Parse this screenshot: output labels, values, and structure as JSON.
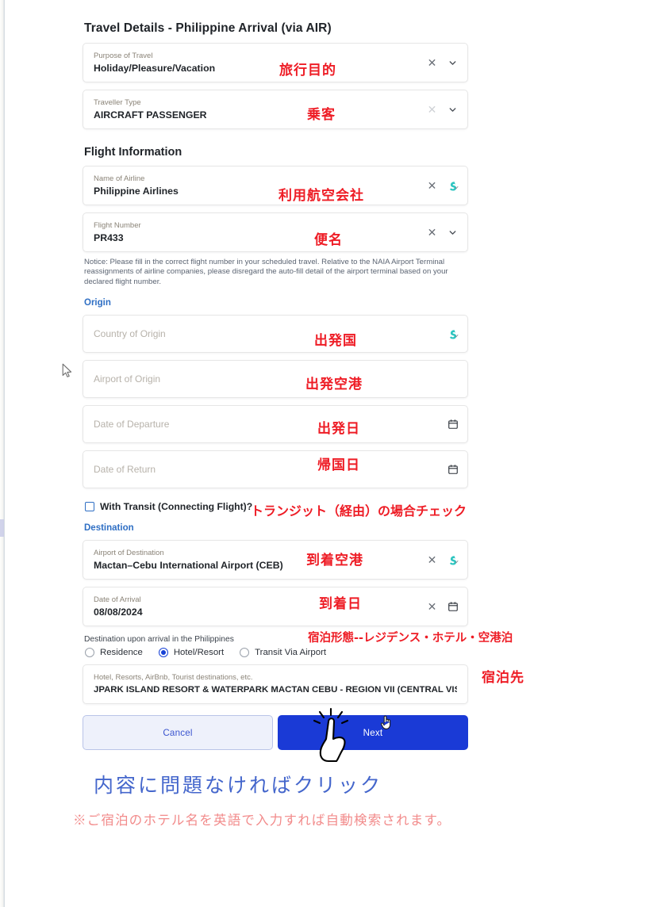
{
  "page": {
    "title": "Travel Details - Philippine Arrival (via AIR)",
    "flight_section_title": "Flight Information"
  },
  "fields": {
    "purpose": {
      "label": "Purpose of Travel",
      "value": "Holiday/Pleasure/Vacation"
    },
    "traveller_type": {
      "label": "Traveller Type",
      "value": "AIRCRAFT PASSENGER"
    },
    "airline": {
      "label": "Name of Airline",
      "value": "Philippine Airlines"
    },
    "flight_number": {
      "label": "Flight Number",
      "value": "PR433"
    },
    "country_origin": {
      "placeholder": "Country of Origin",
      "value": ""
    },
    "airport_origin": {
      "placeholder": "Airport of Origin",
      "value": ""
    },
    "date_departure": {
      "placeholder": "Date of Departure",
      "value": ""
    },
    "date_return": {
      "placeholder": "Date of Return",
      "value": ""
    },
    "airport_destination": {
      "label": "Airport of Destination",
      "value": "Mactan–Cebu International Airport (CEB)"
    },
    "date_arrival": {
      "label": "Date of Arrival",
      "value": "08/08/2024"
    },
    "hotel": {
      "label": "Hotel, Resorts, AirBnb, Tourist destinations, etc.",
      "value": "JPARK ISLAND RESORT & WATERPARK MACTAN CEBU - REGION VII (CENTRAL VISAYAS) -LAPU-I"
    }
  },
  "notice": "Notice: Please fill in the correct flight number in your scheduled travel. Relative to the NAIA Airport Terminal reassignments of airline companies, please disregard the auto-fill detail of the airport terminal based on your declared flight number.",
  "origin_heading": "Origin",
  "destination_heading": "Destination",
  "transit": {
    "label": "With Transit (Connecting Flight)?",
    "checked": false
  },
  "destination_upon_arrival": {
    "caption": "Destination upon arrival in the Philippines",
    "options": [
      "Residence",
      "Hotel/Resort",
      "Transit Via Airport"
    ],
    "selected": "Hotel/Resort"
  },
  "buttons": {
    "cancel": "Cancel",
    "next": "Next"
  },
  "annotations": {
    "purpose": "旅行目的",
    "traveller_type": "乗客",
    "airline": "利用航空会社",
    "flight_number": "便名",
    "country_origin": "出発国",
    "airport_origin": "出発空港",
    "date_departure": "出発日",
    "date_return": "帰国日",
    "transit": "トランジット（経由）の場合チェック",
    "airport_destination": "到着空港",
    "date_arrival": "到着日",
    "accommodation_type": "宿泊形態--レジデンス・ホテル・空港泊",
    "hotel": "宿泊先",
    "next_button": "内容に問題なければクリック",
    "footnote": "※ご宿泊のホテル名を英語で入力すれば自動検索されます。"
  },
  "colors": {
    "annotation_red": "#ee1c25",
    "annotation_blue": "#4466cc",
    "footnote_pink": "#f28b8b",
    "primary_blue": "#1a3ad6",
    "link_blue": "#2f6fc4",
    "autofill_teal": "#2ec5c0"
  }
}
